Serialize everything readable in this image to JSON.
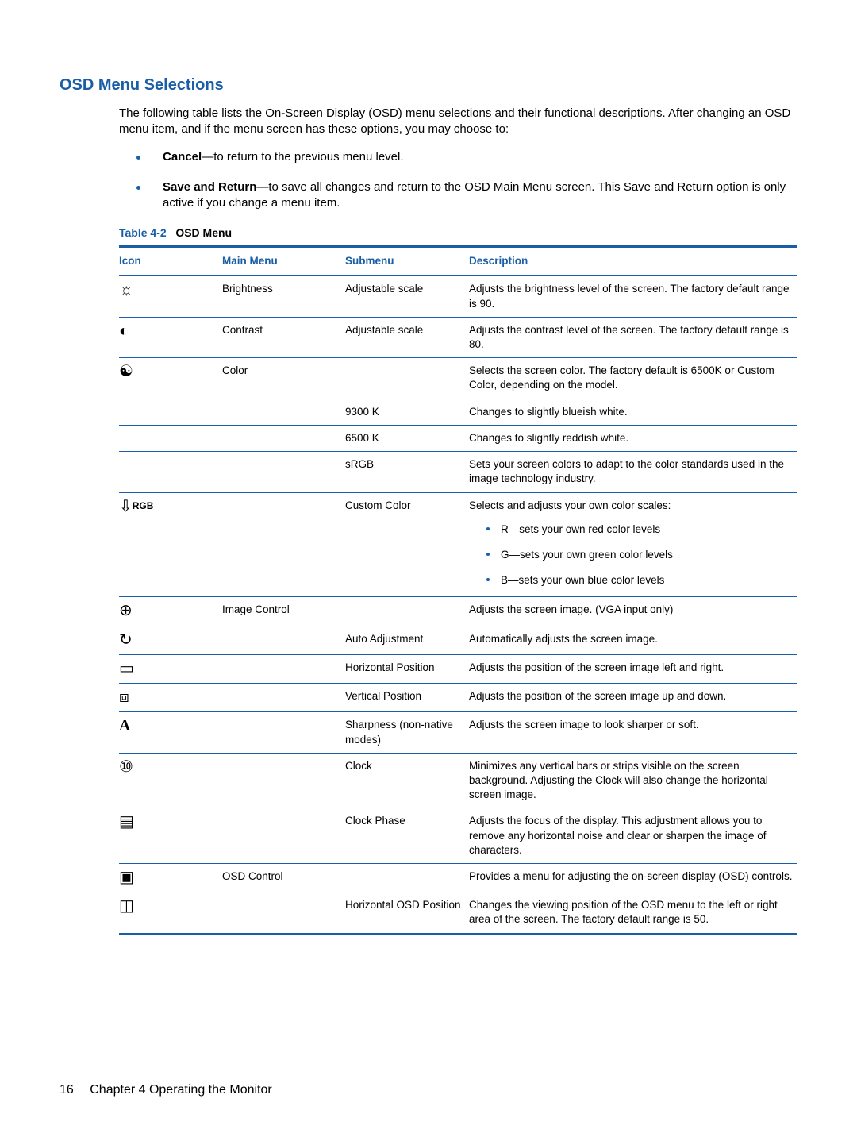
{
  "heading": "OSD Menu Selections",
  "intro": "The following table lists the On-Screen Display (OSD) menu selections and their functional descriptions. After changing an OSD menu item, and if the menu screen has these options, you may choose to:",
  "bullets": [
    {
      "bold": "Cancel",
      "rest": "—to return to the previous menu level."
    },
    {
      "bold": "Save and Return",
      "rest": "—to save all changes and return to the OSD Main Menu screen. This Save and Return option is only active if you change a menu item."
    }
  ],
  "table_caption_label": "Table 4-2",
  "table_caption_title": "OSD Menu",
  "headers": {
    "icon": "Icon",
    "main": "Main Menu",
    "sub": "Submenu",
    "desc": "Description"
  },
  "rows": [
    {
      "icon": "brightness",
      "main": "Brightness",
      "sub": "Adjustable scale",
      "desc": "Adjusts the brightness level of the screen. The factory default range is 90."
    },
    {
      "icon": "contrast",
      "main": "Contrast",
      "sub": "Adjustable scale",
      "desc": "Adjusts the contrast level of the screen. The factory default range is 80."
    },
    {
      "icon": "color",
      "main": "Color",
      "sub": "",
      "desc": "Selects the screen color. The factory default is 6500K or Custom Color, depending on the model."
    },
    {
      "icon": "",
      "main": "",
      "sub": "9300 K",
      "desc": "Changes to slightly blueish white."
    },
    {
      "icon": "",
      "main": "",
      "sub": "6500 K",
      "desc": "Changes to slightly reddish white."
    },
    {
      "icon": "",
      "main": "",
      "sub": "sRGB",
      "desc": "Sets your screen colors to adapt to the color standards used in the image technology industry."
    },
    {
      "icon": "rgb",
      "main": "",
      "sub": "Custom Color",
      "desc": "Selects and adjusts your own color scales:",
      "sub_bullets": [
        "R—sets your own red color levels",
        "G—sets your own green color levels",
        "B—sets your own blue color levels"
      ]
    },
    {
      "icon": "image-control",
      "main": "Image Control",
      "sub": "",
      "desc": "Adjusts the screen image. (VGA input only)"
    },
    {
      "icon": "auto-adjust",
      "main": "",
      "sub": "Auto Adjustment",
      "desc": "Automatically adjusts the screen image."
    },
    {
      "icon": "h-position",
      "main": "",
      "sub": "Horizontal Position",
      "desc": "Adjusts the position of the screen image left and right."
    },
    {
      "icon": "v-position",
      "main": "",
      "sub": "Vertical Position",
      "desc": "Adjusts the position of the screen image up and down."
    },
    {
      "icon": "sharpness",
      "main": "",
      "sub": "Sharpness (non-native modes)",
      "desc": "Adjusts the screen image to look sharper or soft."
    },
    {
      "icon": "clock",
      "main": "",
      "sub": "Clock",
      "desc": "Minimizes any vertical bars or strips visible on the screen background. Adjusting the Clock will also change the horizontal screen image."
    },
    {
      "icon": "clock-phase",
      "main": "",
      "sub": "Clock Phase",
      "desc": "Adjusts the focus of the display. This adjustment allows you to remove any horizontal noise and clear or sharpen the image of characters."
    },
    {
      "icon": "osd-control",
      "main": "OSD Control",
      "sub": "",
      "desc": "Provides a menu for adjusting the on-screen display (OSD) controls."
    },
    {
      "icon": "h-osd",
      "main": "",
      "sub": "Horizontal OSD Position",
      "desc": "Changes the viewing position of the OSD menu to the left or right area of the screen. The factory default range is 50."
    }
  ],
  "footer": {
    "page_number": "16",
    "chapter_label": "Chapter 4   Operating the Monitor"
  },
  "icon_glyphs": {
    "brightness": "☼",
    "contrast": "◐",
    "color": "☯",
    "image-control": "⊕",
    "auto-adjust": "↻",
    "h-position": "▭",
    "v-position": "⧈",
    "sharpness": "A",
    "clock": "⑩",
    "clock-phase": "▤",
    "osd-control": "▣",
    "h-osd": "◫"
  },
  "chart_data": {
    "type": "table",
    "title": "Table 4-2  OSD Menu",
    "columns": [
      "Icon",
      "Main Menu",
      "Submenu",
      "Description"
    ],
    "rows": [
      [
        "brightness",
        "Brightness",
        "Adjustable scale",
        "Adjusts the brightness level of the screen. The factory default range is 90."
      ],
      [
        "contrast",
        "Contrast",
        "Adjustable scale",
        "Adjusts the contrast level of the screen. The factory default range is 80."
      ],
      [
        "color",
        "Color",
        "",
        "Selects the screen color. The factory default is 6500K or Custom Color, depending on the model."
      ],
      [
        "",
        "",
        "9300 K",
        "Changes to slightly blueish white."
      ],
      [
        "",
        "",
        "6500 K",
        "Changes to slightly reddish white."
      ],
      [
        "",
        "",
        "sRGB",
        "Sets your screen colors to adapt to the color standards used in the image technology industry."
      ],
      [
        "rgb",
        "",
        "Custom Color",
        "Selects and adjusts your own color scales: R—sets your own red color levels; G—sets your own green color levels; B—sets your own blue color levels"
      ],
      [
        "image-control",
        "Image Control",
        "",
        "Adjusts the screen image. (VGA input only)"
      ],
      [
        "auto-adjust",
        "",
        "Auto Adjustment",
        "Automatically adjusts the screen image."
      ],
      [
        "h-position",
        "",
        "Horizontal Position",
        "Adjusts the position of the screen image left and right."
      ],
      [
        "v-position",
        "",
        "Vertical Position",
        "Adjusts the position of the screen image up and down."
      ],
      [
        "sharpness",
        "",
        "Sharpness (non-native modes)",
        "Adjusts the screen image to look sharper or soft."
      ],
      [
        "clock",
        "",
        "Clock",
        "Minimizes any vertical bars or strips visible on the screen background. Adjusting the Clock will also change the horizontal screen image."
      ],
      [
        "clock-phase",
        "",
        "Clock Phase",
        "Adjusts the focus of the display. This adjustment allows you to remove any horizontal noise and clear or sharpen the image of characters."
      ],
      [
        "osd-control",
        "OSD Control",
        "",
        "Provides a menu for adjusting the on-screen display (OSD) controls."
      ],
      [
        "h-osd",
        "",
        "Horizontal OSD Position",
        "Changes the viewing position of the OSD menu to the left or right area of the screen. The factory default range is 50."
      ]
    ]
  }
}
